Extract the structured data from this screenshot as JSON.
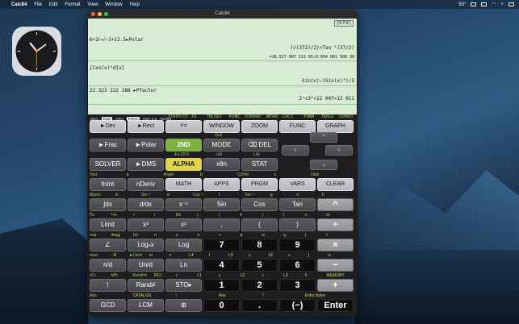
{
  "menubar": {
    "app_name": "Calc84",
    "items": [
      "File",
      "Edit",
      "Format",
      "View",
      "Window",
      "Help"
    ],
    "temp": "50°"
  },
  "window": {
    "title": "Calc84",
    "lights": [
      "#ff5f57",
      "#febc2e",
      "#28c840"
    ]
  },
  "screen": {
    "frac_flag": "[5⁄7⁄9]",
    "entries": [
      {
        "input": "6+2𝑖→√−1+12.5►Polar",
        "result": "(√(372)/2)∠Tan⁻¹(37/2)",
        "result2": "=18.527 007 313 05∠0.054 001 500 38"
      },
      {
        "input": "∫Cos(x)²d[x]",
        "result": "Sin(x)−(Sin(x)³)/3"
      },
      {
        "input": "22 323 222 288 ►Pfactor",
        "result": "2⁴×3²×12 007×12 911"
      }
    ]
  },
  "status": [
    "DEG",
    "RAD",
    "GRA",
    "FRAC",
    "DEC 6.5",
    "NORM"
  ],
  "status_active": [
    "RAD",
    "FRAC"
  ],
  "keys": {
    "r1": [
      "►Dec",
      "►Rect",
      "Y=",
      "WINDOW",
      "ZOOM",
      "FUNC",
      "GRAPH"
    ],
    "r1_labels": [
      "STATPLOT",
      "F1",
      "TBLSET",
      "FUNC",
      "FORMAT",
      "MTRX",
      "CALC",
      "YVAR",
      "TABLE",
      "CONST"
    ],
    "r2": [
      "►Frac",
      "►Polar",
      "2ND",
      "MODE",
      "⌫ DEL"
    ],
    "r2_labels": [
      "Quit"
    ],
    "r3": [
      "SOLVER",
      "►DMS",
      "ALPHA",
      "xθn",
      "STAT"
    ],
    "r3_labels": [
      "A-LOCK",
      "n/d",
      "List"
    ],
    "r4": [
      "fnInt",
      "nDeriv",
      "MATH",
      "APPS",
      "PRGM",
      "VARS",
      "CLEAR"
    ],
    "r4_labels": [
      "Test",
      "a",
      "Angle",
      "b",
      "CONV",
      "c",
      "Distr"
    ],
    "r5": [
      "∫dx",
      "d/dx",
      "x⁻¹",
      "Sin",
      "Cos",
      "Tan",
      "^"
    ],
    "r5_labels": [
      "Matrix",
      "d",
      "Sin⁻¹",
      "e",
      "Cos⁻¹",
      "f",
      "Tan⁻¹",
      "g",
      "π",
      "h"
    ],
    "r6": [
      "Limit",
      "x³",
      "x²",
      ",",
      "(",
      ")",
      "÷"
    ],
    "r6_labels": [
      "∛x",
      "³√x",
      "√",
      "i",
      "EE",
      "j",
      "{",
      "k",
      "}",
      "l",
      "e",
      "m"
    ],
    "r7": [
      "∠",
      "Logₙx",
      "Log",
      "7",
      "8",
      "9",
      "×"
    ],
    "r7_labels": [
      "real",
      "imag",
      "10ˣ",
      "n",
      "u",
      "o",
      "v",
      "p",
      "w",
      "q",
      "[",
      "r"
    ],
    "r8": [
      "n/d",
      "Un/d",
      "Ln",
      "4",
      "5",
      "6",
      "−"
    ],
    "r8_labels": [
      "mod",
      "→R",
      "►Un/d",
      "eˣ",
      "s",
      "L4",
      "t",
      "L5",
      "u",
      "L6",
      "v",
      "]",
      "w"
    ],
    "r9": [
      "!",
      "Rand#",
      "STO▸",
      "1",
      "2",
      "3",
      "+"
    ],
    "r9_labels": [
      "nCr",
      "nPr",
      "RandInt",
      "RCL",
      "x",
      "L1",
      "y",
      "L2",
      "z",
      "L3",
      "θ",
      "MEMORY"
    ],
    "r10": [
      "GCD",
      "LCM",
      "⊞",
      "0",
      ".",
      "(−)",
      "Enter"
    ],
    "r10_labels": [
      "Abs",
      "CATALOG",
      "i",
      "Ans",
      "?",
      "Entry Solve"
    ]
  }
}
